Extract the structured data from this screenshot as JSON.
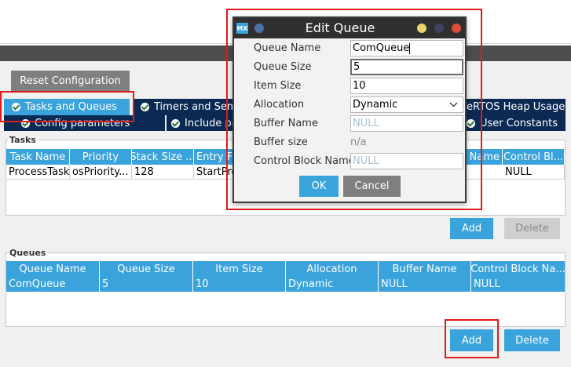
{
  "toolbar": {
    "reset_label": "Reset Configuration"
  },
  "tabs": {
    "row1": [
      {
        "label": "Tasks and Queues",
        "active": true
      },
      {
        "label": "Timers and Sem"
      },
      {
        "label": "eRTOS Heap Usage"
      }
    ],
    "row2": [
      {
        "label": "Config parameters"
      },
      {
        "label": "Include pa"
      },
      {
        "label": "User Constants"
      }
    ]
  },
  "tasks": {
    "legend": "Tasks",
    "columns": [
      "Task Name",
      "Priority",
      "Stack Size ...",
      "Entry F",
      "r Name",
      "Control Bl..."
    ],
    "rows": [
      [
        "ProcessTask",
        "osPriority...",
        "128",
        "StartPro",
        "",
        "NULL"
      ]
    ],
    "add_label": "Add",
    "delete_label": "Delete"
  },
  "queues": {
    "legend": "Queues",
    "columns": [
      "Queue Name",
      "Queue Size",
      "Item Size",
      "Allocation",
      "Buffer Name",
      "Control Block Na..."
    ],
    "rows": [
      [
        "ComQueue",
        "5",
        "10",
        "Dynamic",
        "NULL",
        "NULL"
      ]
    ],
    "add_label": "Add",
    "delete_label": "Delete"
  },
  "dialog": {
    "badge": "MX",
    "title": "Edit Queue",
    "fields": {
      "queue_name": {
        "label": "Queue Name",
        "value": "ComQueue"
      },
      "queue_size": {
        "label": "Queue Size",
        "value": "5"
      },
      "item_size": {
        "label": "Item Size",
        "value": "10"
      },
      "allocation": {
        "label": "Allocation",
        "value": "Dynamic"
      },
      "buffer_name": {
        "label": "Buffer Name",
        "placeholder": "NULL"
      },
      "buffer_size": {
        "label": "Buffer size",
        "value": "n/a"
      },
      "control_block_name": {
        "label": "Control Block Name",
        "placeholder": "NULL"
      }
    },
    "ok_label": "OK",
    "cancel_label": "Cancel"
  },
  "colors": {
    "accent": "#3aa3dc",
    "tab_dark": "#0a2a54",
    "highlight_red": "#e01b1b",
    "dialog_title": "#2f2f2f"
  }
}
